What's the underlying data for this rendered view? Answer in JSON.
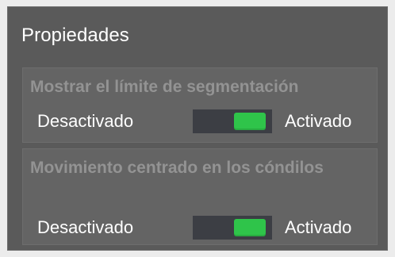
{
  "panel": {
    "title": "Propiedades",
    "sections": [
      {
        "title": "Mostrar el límite de segmentación",
        "off_label": "Desactivado",
        "on_label": "Activado",
        "state": "on"
      },
      {
        "title": "Movimiento centrado en los cóndilos",
        "off_label": "Desactivado",
        "on_label": "Activado",
        "state": "on"
      }
    ]
  },
  "colors": {
    "page_background": "#ececec",
    "panel_background": "#5a5a5a",
    "section_background": "#646464",
    "switch_track": "#3c3e44",
    "switch_knob_on": "#2fc44a",
    "section_title_text": "#939393",
    "text": "#ffffff"
  }
}
